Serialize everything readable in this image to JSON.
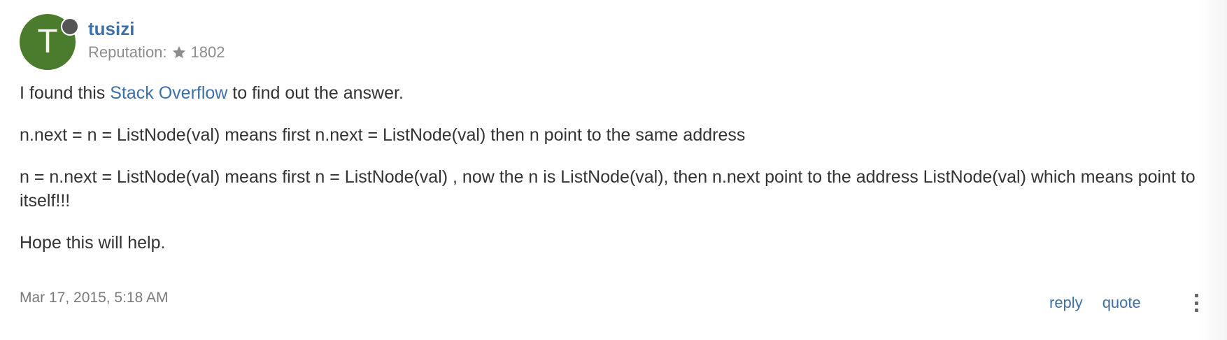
{
  "user": {
    "avatar_letter": "T",
    "name": "tusizi",
    "reputation_label": "Reputation:",
    "reputation_value": "1802",
    "status_icon": "online-status-dot"
  },
  "post": {
    "line1_prefix": "I found this ",
    "line1_link": "Stack Overflow",
    "line1_suffix": " to find out the answer.",
    "paragraph2": "n.next = n = ListNode(val) means first n.next = ListNode(val) then n point to the same address",
    "paragraph3": "n = n.next = ListNode(val) means first n = ListNode(val) , now the n is ListNode(val), then n.next point to the address ListNode(val) which means point to itself!!!",
    "paragraph4": "Hope this will help."
  },
  "footer": {
    "timestamp": "Mar 17, 2015, 5:18 AM",
    "reply_label": "reply",
    "quote_label": "quote",
    "more_icon": "vertical-ellipsis-icon"
  },
  "colors": {
    "link": "#3d6fa8",
    "avatar_bg": "#4b7b2c",
    "muted_text": "#8c8c8c"
  }
}
